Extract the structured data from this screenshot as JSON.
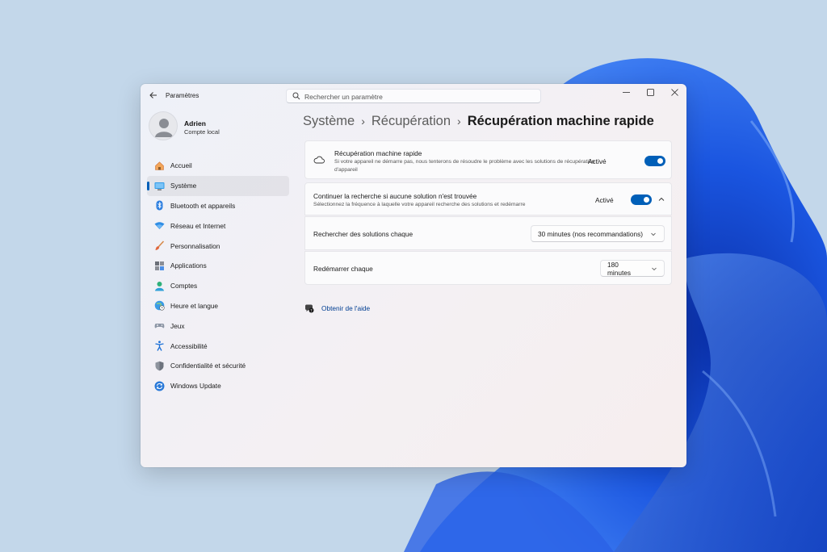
{
  "window": {
    "title": "Paramètres",
    "search_placeholder": "Rechercher un paramètre"
  },
  "profile": {
    "name": "Adrien",
    "account_type": "Compte local"
  },
  "sidebar": {
    "items": [
      {
        "label": "Accueil",
        "icon": "home-icon",
        "active": false
      },
      {
        "label": "Système",
        "icon": "system-icon",
        "active": true
      },
      {
        "label": "Bluetooth et appareils",
        "icon": "bluetooth-icon",
        "active": false
      },
      {
        "label": "Réseau et Internet",
        "icon": "wifi-icon",
        "active": false
      },
      {
        "label": "Personnalisation",
        "icon": "brush-icon",
        "active": false
      },
      {
        "label": "Applications",
        "icon": "apps-icon",
        "active": false
      },
      {
        "label": "Comptes",
        "icon": "account-icon",
        "active": false
      },
      {
        "label": "Heure et langue",
        "icon": "globe-icon",
        "active": false
      },
      {
        "label": "Jeux",
        "icon": "gamepad-icon",
        "active": false
      },
      {
        "label": "Accessibilité",
        "icon": "accessibility-icon",
        "active": false
      },
      {
        "label": "Confidentialité et sécurité",
        "icon": "shield-icon",
        "active": false
      },
      {
        "label": "Windows Update",
        "icon": "update-icon",
        "active": false
      }
    ]
  },
  "breadcrumb": {
    "level1": "Système",
    "level2": "Récupération",
    "current": "Récupération machine rapide",
    "separator": "›"
  },
  "recovery": {
    "title": "Récupération machine rapide",
    "description": "Si votre appareil ne démarre pas, nous tenterons de résoudre le problème avec les solutions de récupération d'appareil",
    "state": "Activé",
    "enabled": true
  },
  "continue_search": {
    "title": "Continuer la recherche si aucune solution n'est trouvée",
    "description": "Sélectionnez la fréquence à laquelle votre appareil recherche des solutions et redémarre",
    "state": "Activé",
    "enabled": true
  },
  "search_interval": {
    "label": "Rechercher des solutions chaque",
    "value": "30 minutes (nos recommandations)"
  },
  "restart_interval": {
    "label": "Redémarrer chaque",
    "value": "180 minutes"
  },
  "help": {
    "label": "Obtenir de l'aide"
  },
  "colors": {
    "accent": "#005fb8",
    "link": "#003e92"
  }
}
